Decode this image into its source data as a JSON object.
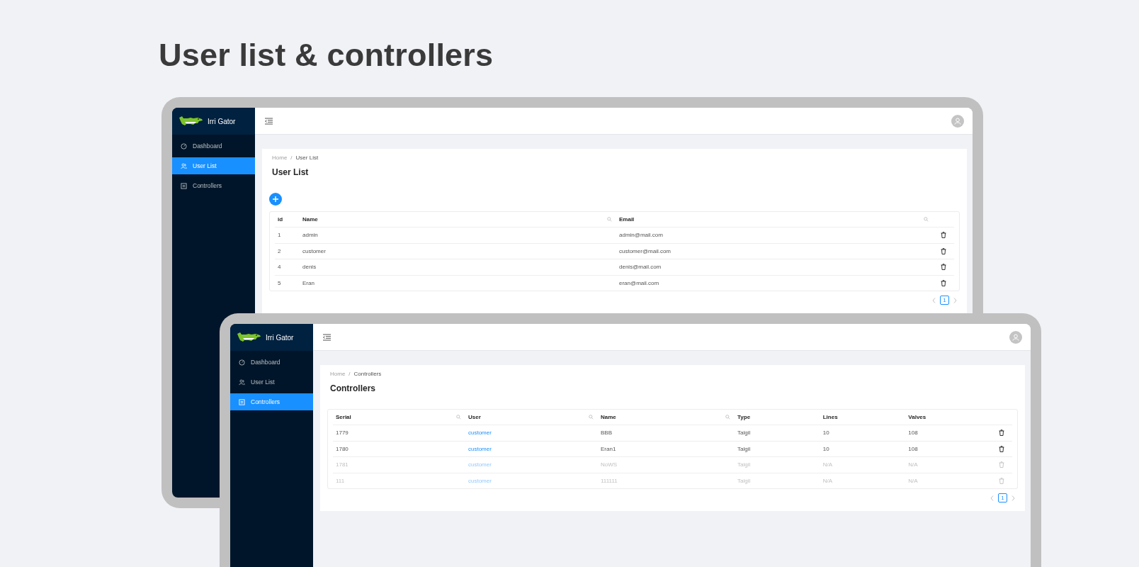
{
  "title": "User list & controllers",
  "screens": [
    {
      "kind": "users",
      "brand": "Irri Gator",
      "nav": [
        {
          "label": "Dashboard",
          "selected": false
        },
        {
          "label": "User List",
          "selected": true
        },
        {
          "label": "Controllers",
          "selected": false
        }
      ],
      "breadcrumb": [
        "Home",
        "User List"
      ],
      "breadcrumb_separator": "/",
      "page_title": "User List",
      "add_button": true,
      "table": {
        "columns": [
          {
            "label": "id",
            "searchable": false,
            "kind": "text"
          },
          {
            "label": "Name",
            "searchable": true,
            "kind": "text"
          },
          {
            "label": "Email",
            "searchable": true,
            "kind": "text"
          }
        ],
        "rows": [
          {
            "cells": [
              "1",
              "admin",
              "admin@mail.com"
            ],
            "disabled": false
          },
          {
            "cells": [
              "2",
              "customer",
              "customer@mail.com"
            ],
            "disabled": false
          },
          {
            "cells": [
              "4",
              "denis",
              "denis@mail.com"
            ],
            "disabled": false
          },
          {
            "cells": [
              "5",
              "Eran",
              "eran@mail.com"
            ],
            "disabled": false
          }
        ]
      },
      "pagination": [
        {
          "label": "1",
          "selected": true
        }
      ]
    },
    {
      "kind": "controllers",
      "brand": "Irri Gator",
      "nav": [
        {
          "label": "Dashboard",
          "selected": false
        },
        {
          "label": "User List",
          "selected": false
        },
        {
          "label": "Controllers",
          "selected": true
        }
      ],
      "breadcrumb": [
        "Home",
        "Controllers"
      ],
      "breadcrumb_separator": "/",
      "page_title": "Controllers",
      "add_button": false,
      "table": {
        "columns": [
          {
            "label": "Serial",
            "searchable": true,
            "kind": "text"
          },
          {
            "label": "User",
            "searchable": true,
            "kind": "link"
          },
          {
            "label": "Name",
            "searchable": true,
            "kind": "text"
          },
          {
            "label": "Type",
            "searchable": false,
            "kind": "text"
          },
          {
            "label": "Lines",
            "searchable": false,
            "kind": "text"
          },
          {
            "label": "Valves",
            "searchable": false,
            "kind": "text"
          }
        ],
        "rows": [
          {
            "cells": [
              "1779",
              "customer",
              "BBB",
              "Talgil",
              "10",
              "108"
            ],
            "disabled": false
          },
          {
            "cells": [
              "1780",
              "customer",
              "Eran1",
              "Talgil",
              "10",
              "108"
            ],
            "disabled": false
          },
          {
            "cells": [
              "1781",
              "customer",
              "NoWS",
              "Talgil",
              "N/A",
              "N/A"
            ],
            "disabled": true
          },
          {
            "cells": [
              "111",
              "customer",
              "111111",
              "Talgil",
              "N/A",
              "N/A"
            ],
            "disabled": true
          }
        ]
      },
      "pagination": [
        {
          "label": "1",
          "selected": true
        }
      ]
    }
  ]
}
